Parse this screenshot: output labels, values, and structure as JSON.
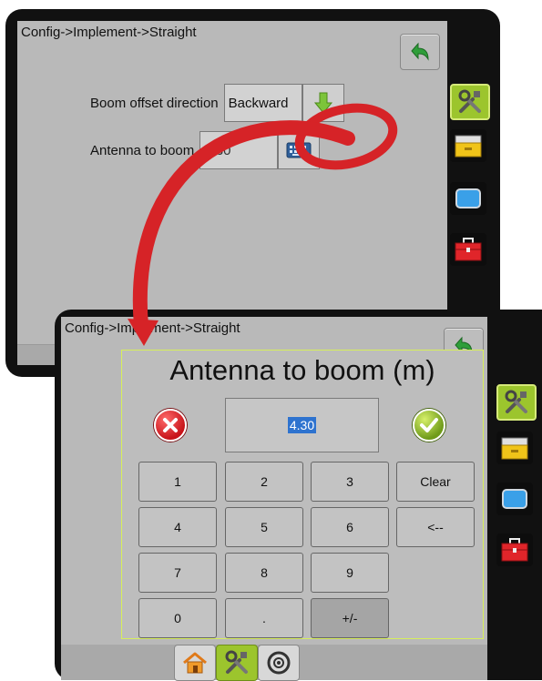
{
  "back_screen": {
    "breadcrumb": "Config->Implement->Straight",
    "boom_offset": {
      "label": "Boom offset direction",
      "value": "Backward"
    },
    "antenna": {
      "label": "Antenna to boom",
      "value": "4.30"
    }
  },
  "front_screen": {
    "breadcrumb": "Config->Implement->Straight",
    "dialog": {
      "title": "Antenna to boom (m)",
      "value": "4.30",
      "keys": [
        "1",
        "2",
        "3",
        "Clear",
        "4",
        "5",
        "6",
        "<--",
        "7",
        "8",
        "9",
        "0",
        ".",
        "+/-"
      ]
    }
  },
  "icons": {
    "back": "back-arrow-icon",
    "tools": "tools-icon",
    "folder": "folder-icon",
    "screen": "screen-icon",
    "toolbox": "toolbox-icon",
    "down": "down-arrow-icon",
    "keyboard": "keyboard-icon",
    "home": "home-icon",
    "gauge": "gauge-icon"
  },
  "colors": {
    "accent": "#d62327",
    "active": "#9cc52d",
    "selection": "#2e73cf"
  }
}
